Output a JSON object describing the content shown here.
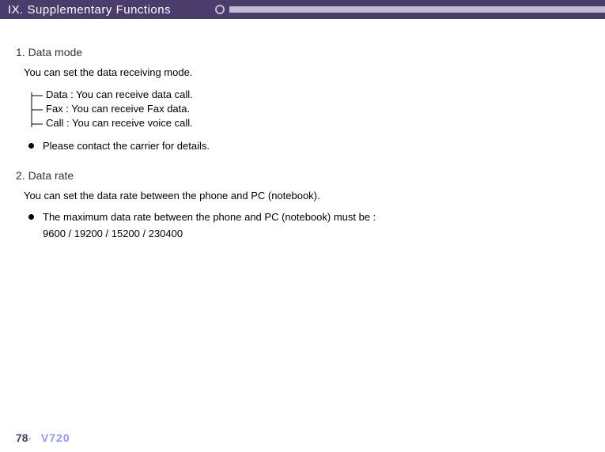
{
  "header": {
    "title": "IX. Supplementary Functions"
  },
  "section1": {
    "title": "1. Data mode",
    "desc": "You can set the data receiving mode.",
    "options": {
      "data": "Data : You can receive data call.",
      "fax": "Fax : You can receive Fax data.",
      "call": "Call : You can receive voice call."
    },
    "bullet": "Please contact the carrier for details."
  },
  "section2": {
    "title": "2. Data rate",
    "desc": "You can set the data rate between the phone and PC (notebook).",
    "bullet": "The maximum data rate between the phone and PC (notebook) must be :",
    "bullet_sub": "9600 / 19200 / 15200 / 230400"
  },
  "footer": {
    "page": "78",
    "dot": "·",
    "model": "V720"
  }
}
